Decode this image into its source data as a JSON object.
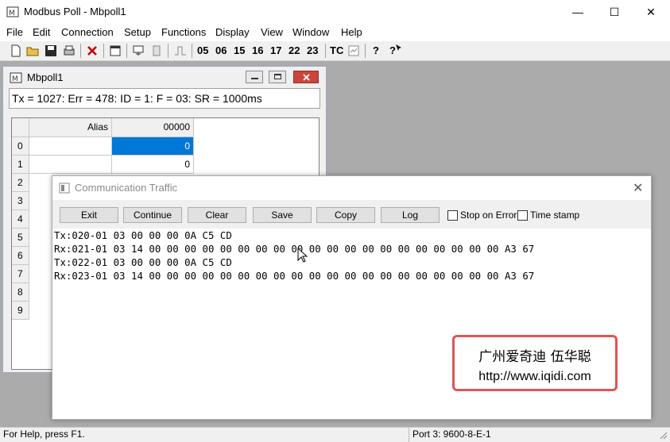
{
  "app": {
    "title": "Modbus Poll - Mbpoll1",
    "minimize_glyph": "—",
    "maximize_glyph": "☐",
    "close_glyph": "✕"
  },
  "menu": [
    "File",
    "Edit",
    "Connection",
    "Setup",
    "Functions",
    "Display",
    "View",
    "Window",
    "Help"
  ],
  "toolbar": {
    "function_codes": [
      "05",
      "06",
      "15",
      "16",
      "17",
      "22",
      "23"
    ],
    "tc_label": "TC",
    "help_glyph": "?",
    "context_help_glyph": "?"
  },
  "child": {
    "title": "Mbpoll1",
    "status": "Tx = 1027: Err = 478: ID = 1: F = 03: SR = 1000ms",
    "grid": {
      "col_alias": "Alias",
      "col_addr": "00000",
      "rows": [
        "0",
        "1",
        "2",
        "3",
        "4",
        "5",
        "6",
        "7",
        "8",
        "9"
      ],
      "values": [
        "0",
        "0"
      ]
    }
  },
  "traffic": {
    "title": "Communication Traffic",
    "close_glyph": "✕",
    "buttons": [
      "Exit",
      "Continue",
      "Clear",
      "Save",
      "Copy",
      "Log"
    ],
    "stop_on_error": "Stop on Error",
    "time_stamp": "Time stamp",
    "log": [
      {
        "dir": "Tx",
        "text": ":020-01 03 00 00 00 0A C5 CD"
      },
      {
        "dir": "Rx",
        "text": ":021-01 03 14 00 00 00 00 00 00 00 00 00 00 00 00 00 00 00 00 00 00 00 00 A3 67"
      },
      {
        "dir": "Tx",
        "text": ":022-01 03 00 00 00 0A C5 CD"
      },
      {
        "dir": "Rx",
        "text": ":023-01 03 14 00 00 00 00 00 00 00 00 00 00 00 00 00 00 00 00 00 00 00 00 A3 67"
      }
    ]
  },
  "watermark": {
    "line1": "广州爱奇迪 伍华聪",
    "line2": "http://www.iqidi.com"
  },
  "statusbar": {
    "help": "For Help, press F1.",
    "port": "Port 3: 9600-8-E-1"
  },
  "colors": {
    "selection": "#0078d7",
    "watermark_border": "#e05555"
  }
}
